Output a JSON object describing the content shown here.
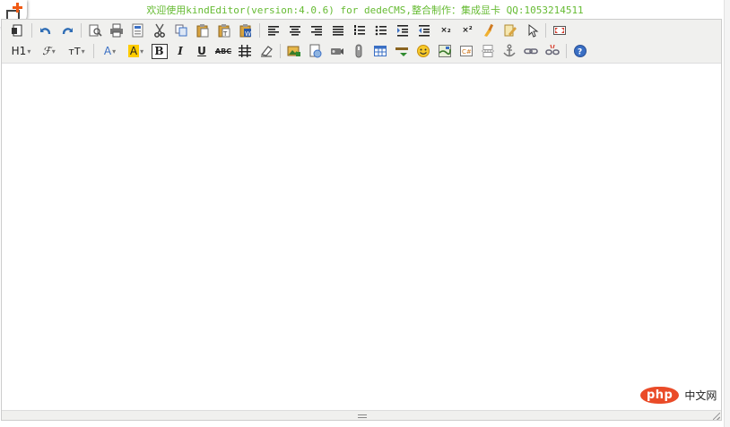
{
  "banner": "欢迎使用kindEditor(version:4.0.6) for dedeCMS,整合制作：集成显卡 QQ:1053214511",
  "toolbar": {
    "heading_label": "H1",
    "fontname_label": "ℱ",
    "fontsize_label": "тT",
    "forecolor_label": "A",
    "hilitecolor_label": "A",
    "bold_label": "B",
    "italic_label": "I",
    "underline_label": "U",
    "strike_label": "ABC",
    "sub_label": "×₂",
    "sup_label": "×²",
    "colors": {
      "blue": "#3a6fc4",
      "orange": "#f0a030",
      "hilite": "#ffcc00",
      "red": "#d83c2c",
      "green": "#5aa03a"
    }
  },
  "watermark": {
    "logo_text": "php",
    "site_text": "中文网"
  }
}
